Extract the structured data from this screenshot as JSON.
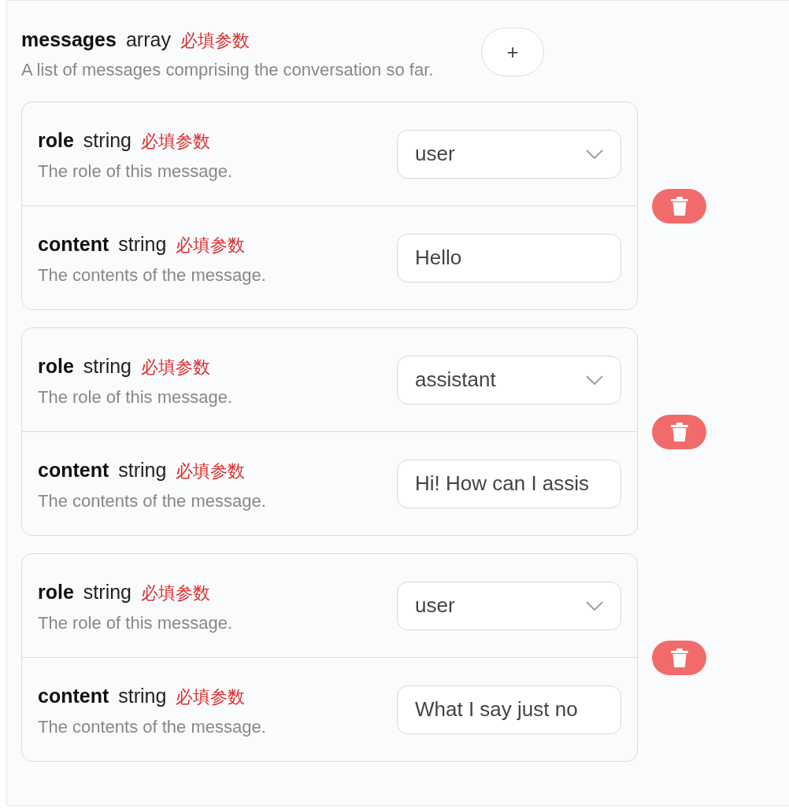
{
  "field": {
    "name": "messages",
    "type": "array",
    "required": "必填参数",
    "description": "A list of messages comprising the conversation so far."
  },
  "add_button": {
    "label": "+"
  },
  "items": [
    {
      "fields": [
        {
          "kind": "select",
          "name": "role",
          "type": "string",
          "required": "必填参数",
          "description": "The role of this message.",
          "value": "user"
        },
        {
          "kind": "text",
          "name": "content",
          "type": "string",
          "required": "必填参数",
          "description": "The contents of the message.",
          "value": "Hello"
        }
      ]
    },
    {
      "fields": [
        {
          "kind": "select",
          "name": "role",
          "type": "string",
          "required": "必填参数",
          "description": "The role of this message.",
          "value": "assistant"
        },
        {
          "kind": "text",
          "name": "content",
          "type": "string",
          "required": "必填参数",
          "description": "The contents of the message.",
          "value": "Hi! How can I assis"
        }
      ]
    },
    {
      "fields": [
        {
          "kind": "select",
          "name": "role",
          "type": "string",
          "required": "必填参数",
          "description": "The role of this message.",
          "value": "user"
        },
        {
          "kind": "text",
          "name": "content",
          "type": "string",
          "required": "必填参数",
          "description": "The contents of the message.",
          "value": "What I say just no"
        }
      ]
    }
  ]
}
